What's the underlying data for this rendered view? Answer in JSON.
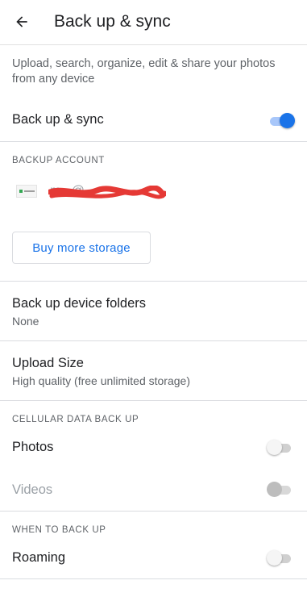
{
  "appbar": {
    "back_icon": "arrow-back-icon",
    "title": "Back up & sync"
  },
  "description": "Upload, search, organize, edit & share your photos from any device",
  "backup_sync": {
    "label": "Back up & sync",
    "enabled": true
  },
  "backup_account": {
    "header": "BACKUP ACCOUNT",
    "email_visible_fragment": "m...@...",
    "buy_storage_label": "Buy more storage"
  },
  "device_folders": {
    "title": "Back up device folders",
    "value": "None"
  },
  "upload_size": {
    "title": "Upload Size",
    "value": "High quality (free unlimited storage)"
  },
  "cellular": {
    "header": "CELLULAR DATA BACK UP",
    "photos_label": "Photos",
    "photos_enabled": false,
    "videos_label": "Videos",
    "videos_enabled": false,
    "videos_disabled": true
  },
  "when_to_back_up": {
    "header": "WHEN TO BACK UP",
    "roaming_label": "Roaming",
    "roaming_enabled": false
  },
  "colors": {
    "accent": "#1a73e8",
    "redaction": "#e53935"
  }
}
